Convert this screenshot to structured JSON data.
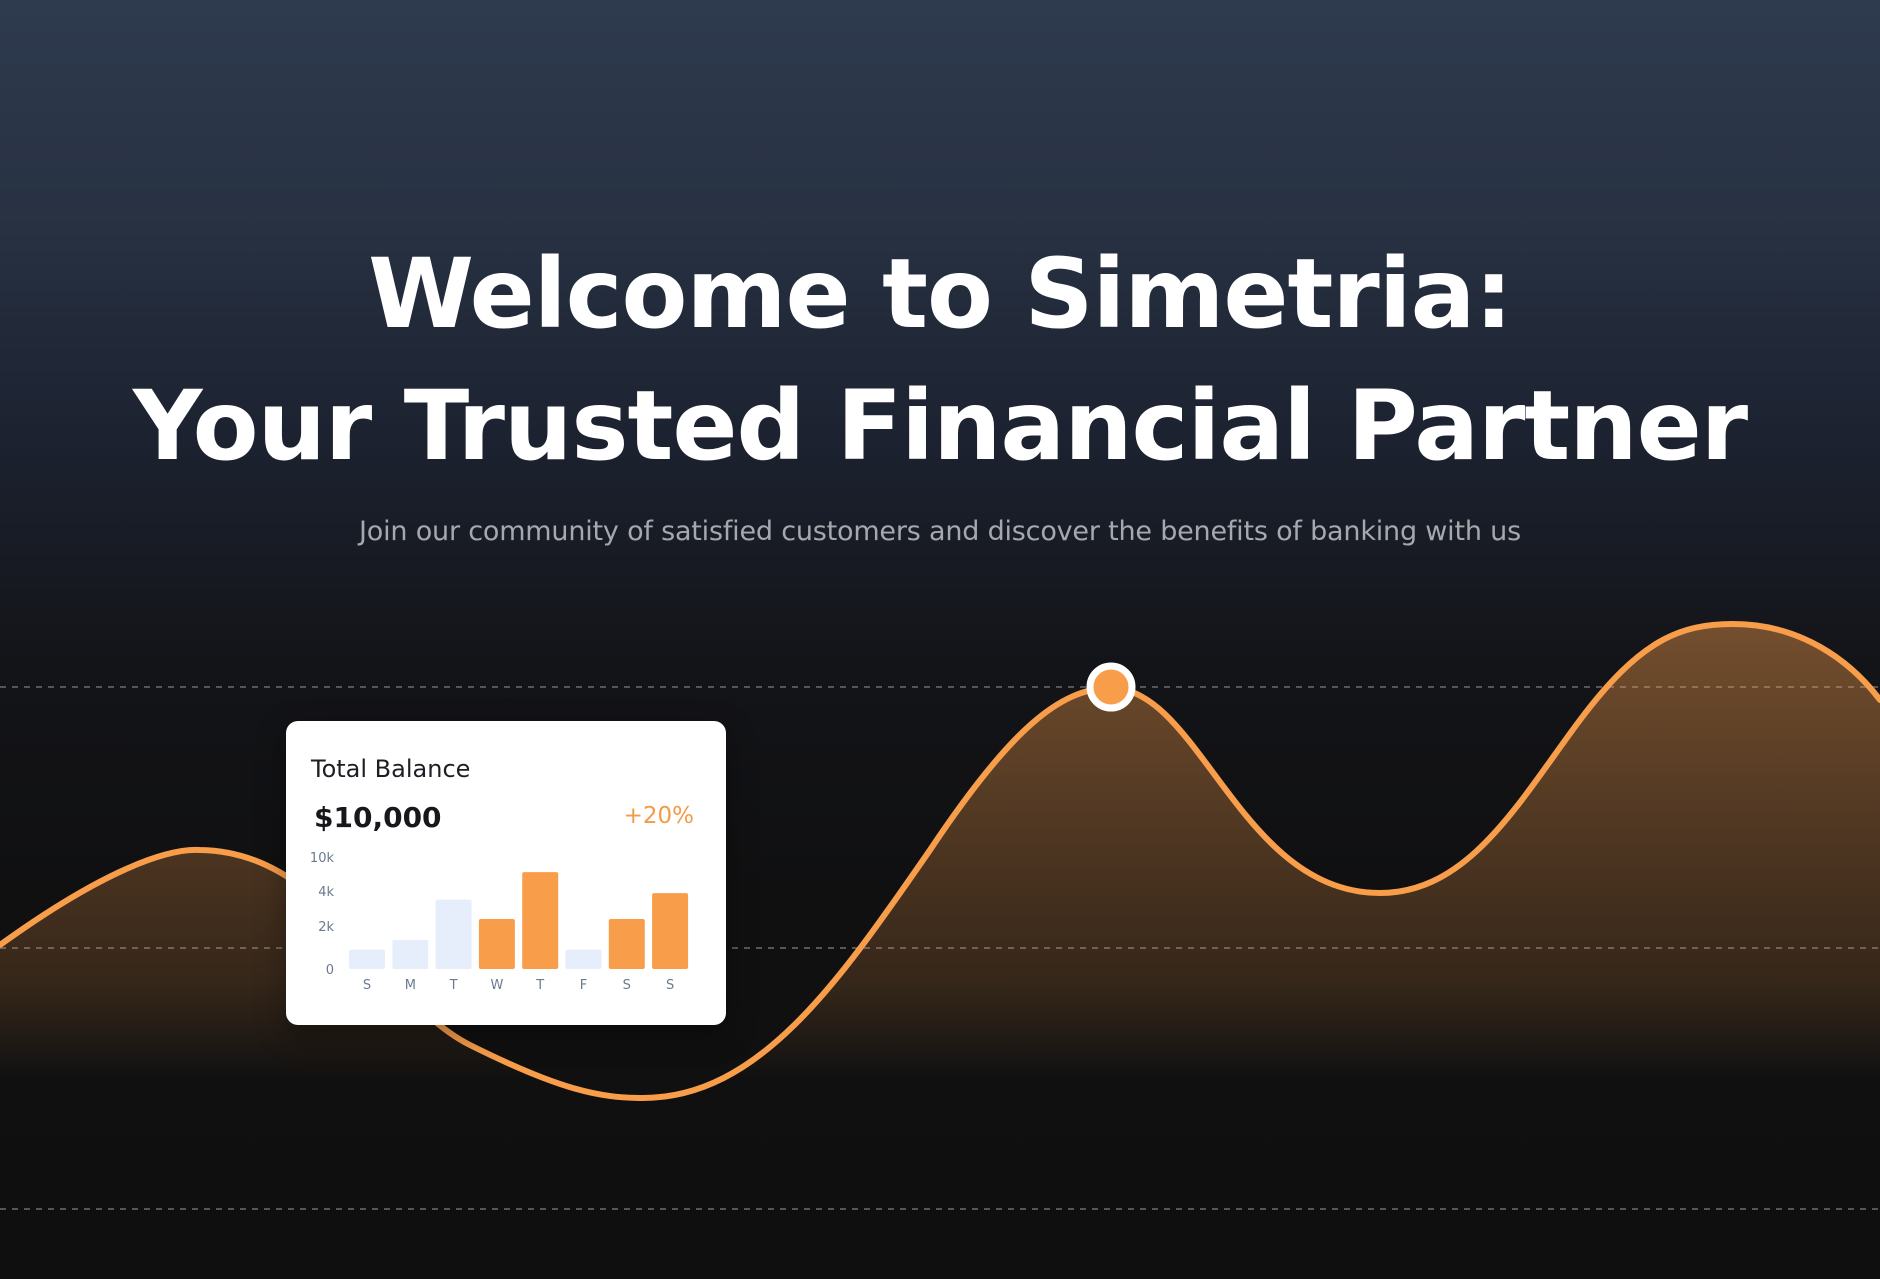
{
  "hero": {
    "title_line1": "Welcome to Simetria:",
    "title_line2": "Your Trusted Financial Partner",
    "subtitle": "Join our community of satisfied customers and discover the benefits of banking with us"
  },
  "balance_card": {
    "label": "Total Balance",
    "amount": "$10,000",
    "change": "+20%"
  },
  "chart_data": {
    "type": "bar",
    "categories": [
      "S",
      "M",
      "T",
      "W",
      "T",
      "F",
      "S",
      "S"
    ],
    "yticks": [
      "0",
      "2k",
      "4k",
      "10k"
    ],
    "values": [
      1200,
      1800,
      4300,
      3100,
      6000,
      1200,
      3100,
      4700
    ],
    "highlighted": [
      false,
      false,
      false,
      true,
      true,
      false,
      true,
      true
    ],
    "colors": {
      "highlight": "#f89d4a",
      "muted": "#e6eefb",
      "tick": "#6b7a90"
    }
  },
  "colors": {
    "accent": "#f89d4a",
    "text_primary": "#ffffff",
    "text_muted": "#a6a8ad"
  }
}
